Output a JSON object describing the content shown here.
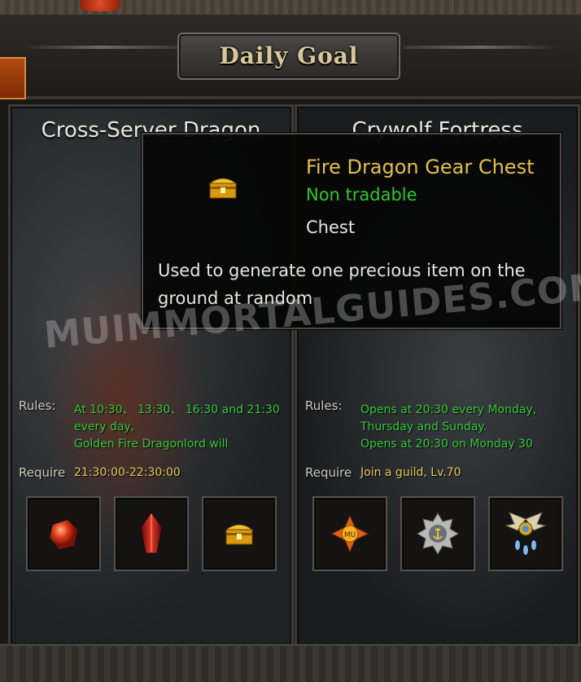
{
  "window": {
    "title": "Daily Goal"
  },
  "cards": [
    {
      "title": "Cross-Server Dragon",
      "rules_label": "Rules:",
      "rules_lines": [
        "At 10:30、 13:30、 16:30 and 21:30",
        "every day,",
        "Golden Fire Dragonlord will"
      ],
      "require_label": "Require",
      "require_value": "21:30:00-22:30:00",
      "rewards": [
        "red-ore-icon",
        "red-crystal-icon",
        "golden-chest-icon"
      ]
    },
    {
      "title": "Crywolf Fortress",
      "rules_label": "Rules:",
      "rules_lines": [
        "Opens at 20:30 every Monday,",
        "Thursday and Sunday.",
        "Opens at 20:30 on Monday 30"
      ],
      "require_label": "Require",
      "require_value": "Join a guild, Lv.70",
      "rewards": [
        "mu-emblem-icon",
        "silver-anchor-badge-icon",
        "winged-pendant-icon"
      ]
    }
  ],
  "tooltip": {
    "item_name": "Fire Dragon Gear Chest",
    "tradability": "Non tradable",
    "item_type": "Chest",
    "description": "Used to generate one precious item on the ground at random",
    "icon": "golden-chest-icon"
  },
  "watermark": "MUIMMORTALGUIDES.COM",
  "colors": {
    "green_text": "#38c83a",
    "gold_text": "#e4c95a",
    "tooltip_name": "#e5c04a"
  }
}
